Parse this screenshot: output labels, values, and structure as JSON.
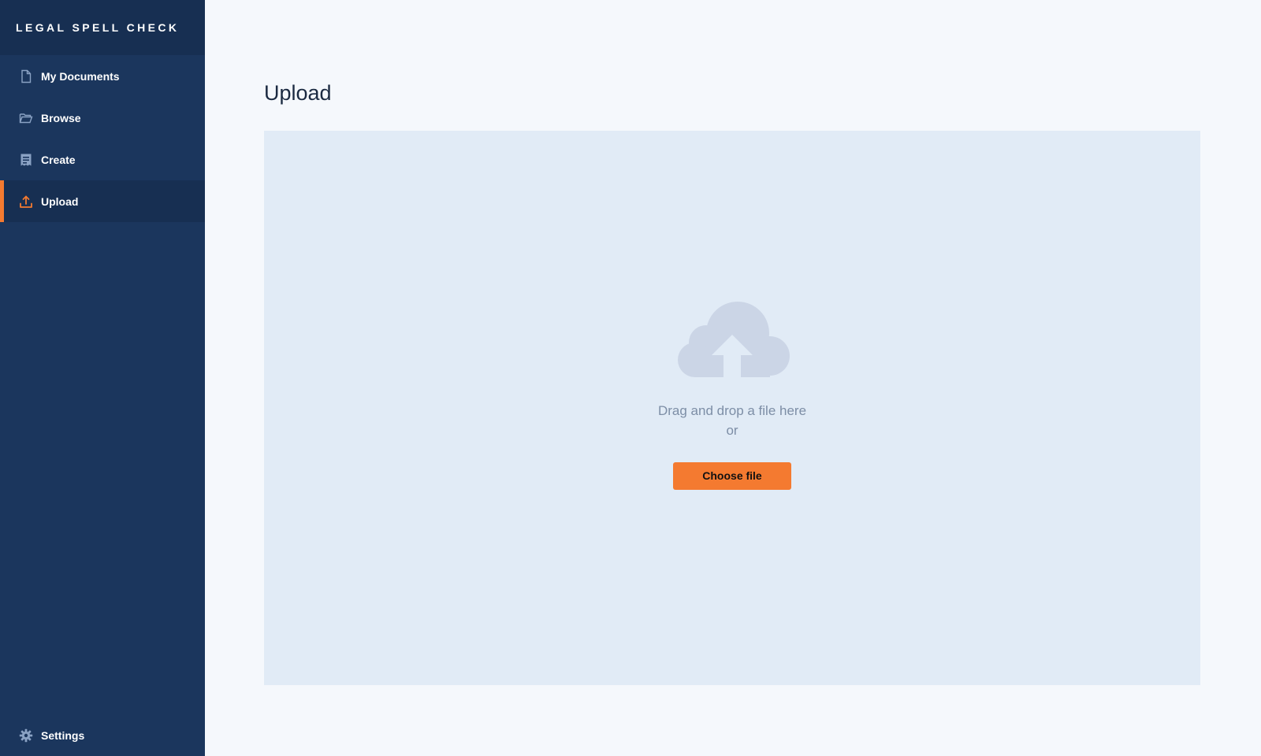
{
  "app": {
    "brand": "LEGAL SPELL CHECK"
  },
  "sidebar": {
    "items": [
      {
        "label": "My Documents",
        "icon": "document-icon",
        "active": false
      },
      {
        "label": "Browse",
        "icon": "folder-open-icon",
        "active": false
      },
      {
        "label": "Create",
        "icon": "create-document-icon",
        "active": false
      },
      {
        "label": "Upload",
        "icon": "upload-icon",
        "active": true
      }
    ],
    "settings": {
      "label": "Settings",
      "icon": "gear-icon"
    }
  },
  "main": {
    "title": "Upload",
    "dropzone": {
      "icon": "cloud-upload-icon",
      "text": "Drag and drop a file here",
      "or": "or",
      "button_label": "Choose file"
    }
  },
  "colors": {
    "sidebar_bg": "#1b365d",
    "sidebar_active_bg": "#172f52",
    "accent": "#f47a30",
    "icon_muted": "#8aa2c4",
    "dropzone_bg": "#e1ebf6",
    "cloud": "#cbd5e6",
    "page_bg": "#f5f8fc"
  }
}
